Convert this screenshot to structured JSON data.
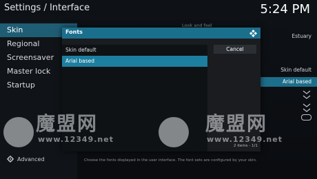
{
  "header": {
    "title": "Settings / Interface",
    "clock": "5:24 PM"
  },
  "sidebar": {
    "items": [
      {
        "label": "Skin",
        "active": true
      },
      {
        "label": "Regional",
        "active": false
      },
      {
        "label": "Screensaver",
        "active": false
      },
      {
        "label": "Master lock",
        "active": false
      },
      {
        "label": "Startup",
        "active": false
      }
    ],
    "advanced_label": "Advanced"
  },
  "content": {
    "section_title": "Look and feel",
    "rows": [
      {
        "value": "Estuary"
      },
      {
        "value": "Skin default"
      },
      {
        "value": "Arial based"
      }
    ],
    "hint": "Choose the fonts displayed in the user interface. The font sets are configured by your skin."
  },
  "dialog": {
    "title": "Fonts",
    "options": [
      {
        "label": "Skin default",
        "selected": false
      },
      {
        "label": "Arial based",
        "selected": true
      }
    ],
    "cancel_label": "Cancel",
    "items_count": "2 items - 1/1"
  },
  "watermark": {
    "text": "魔盟网",
    "url": "www.12349.net"
  },
  "colors": {
    "accent": "#1d7fa0",
    "header": "#1a6f8d",
    "sidebar_active": "#1f5d74"
  }
}
